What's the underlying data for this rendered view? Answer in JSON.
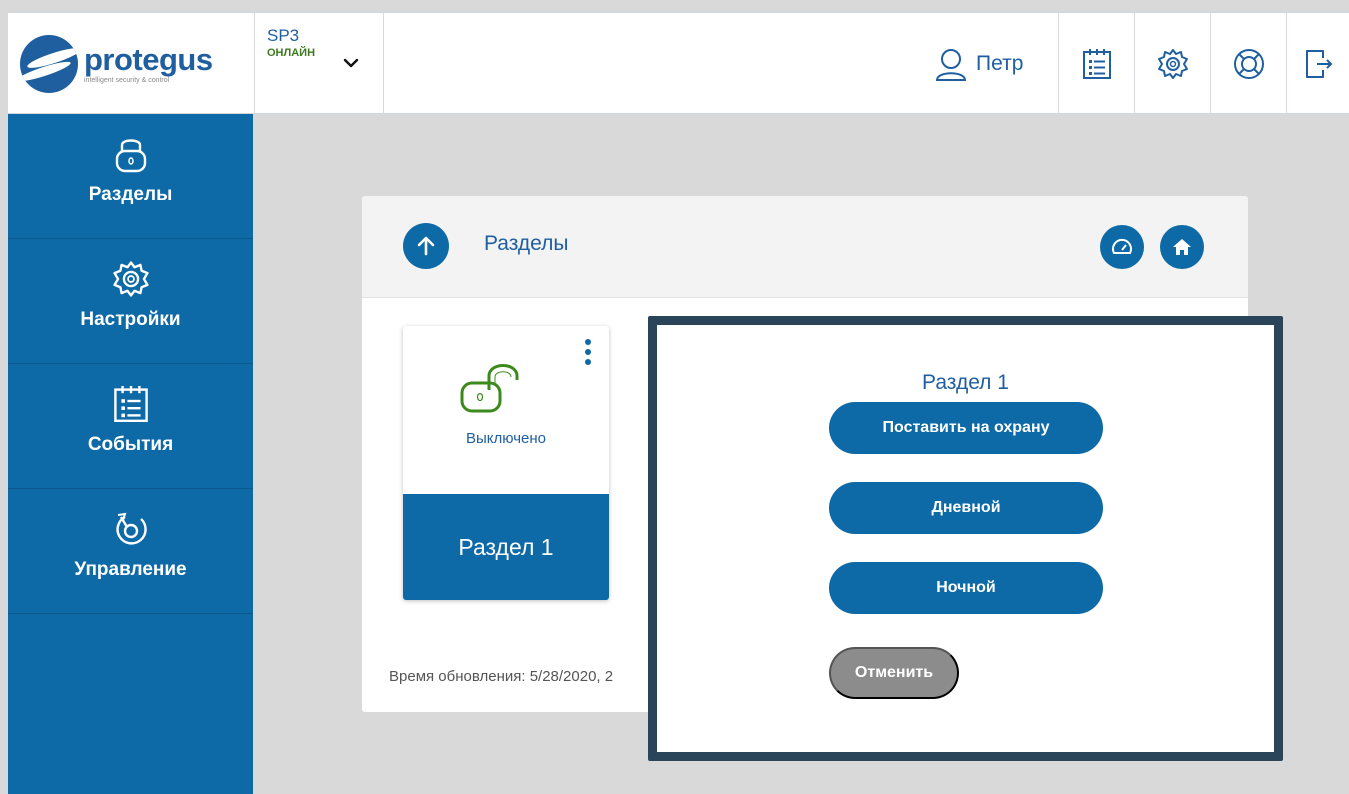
{
  "header": {
    "logo_name": "protegus",
    "logo_tagline": "intelligent security & control",
    "device_name": "SP3",
    "device_status": "ОНЛАЙН",
    "user_name": "Петр",
    "icons": [
      "calendar-list-icon",
      "settings-gear-icon",
      "help-lifebuoy-icon",
      "logout-icon"
    ]
  },
  "sidebar": {
    "items": [
      {
        "label": "Разделы",
        "icon": "padlock-icon"
      },
      {
        "label": "Настройки",
        "icon": "gear-icon"
      },
      {
        "label": "События",
        "icon": "calendar-list-icon"
      },
      {
        "label": "Управление",
        "icon": "control-dial-icon"
      }
    ]
  },
  "main": {
    "title": "Разделы",
    "card": {
      "status": "Выключено",
      "name": "Раздел 1"
    },
    "update_time": "Время обновления: 5/28/2020, 2"
  },
  "modal": {
    "title": "Раздел 1",
    "buttons": [
      "Поставить на охрану",
      "Дневной",
      "Ночной"
    ],
    "cancel": "Отменить"
  },
  "colors": {
    "primary": "#0d6aa6",
    "status_green": "#3d7a1f",
    "cancel_gray": "#8c8c8c",
    "modal_frame": "#2a4559"
  }
}
